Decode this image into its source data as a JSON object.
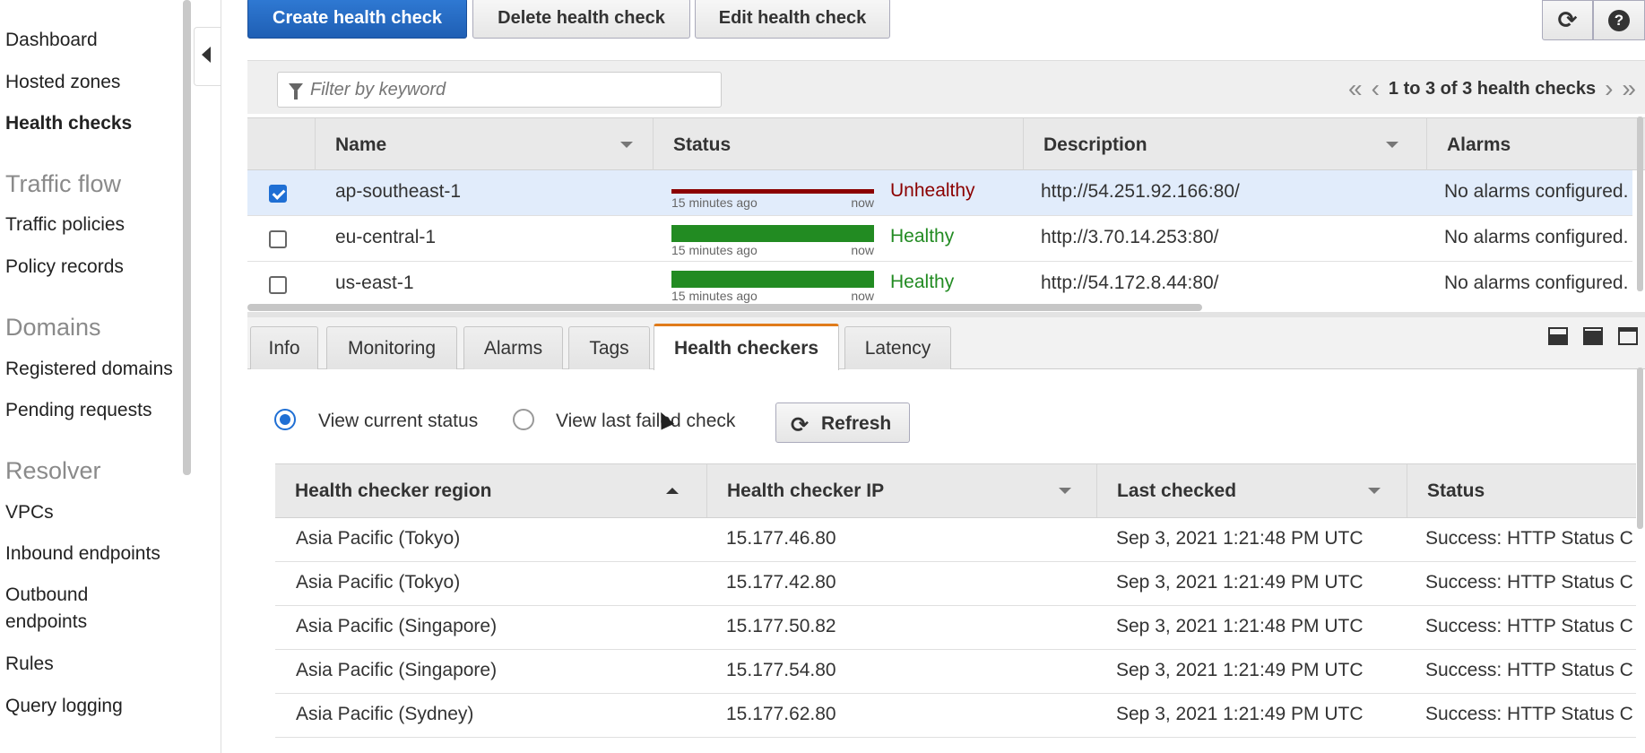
{
  "sidebar": {
    "items": [
      {
        "label": "Dashboard"
      },
      {
        "label": "Hosted zones"
      },
      {
        "label": "Health checks",
        "active": true
      }
    ],
    "sections": [
      {
        "title": "Traffic flow",
        "items": [
          "Traffic policies",
          "Policy records"
        ]
      },
      {
        "title": "Domains",
        "items": [
          "Registered domains",
          "Pending requests"
        ]
      },
      {
        "title": "Resolver",
        "items": [
          "VPCs",
          "Inbound endpoints",
          "Outbound",
          "endpoints",
          "Rules",
          "Query logging"
        ]
      }
    ]
  },
  "toolbar": {
    "create_label": "Create health check",
    "delete_label": "Delete health check",
    "edit_label": "Edit health check"
  },
  "filter": {
    "placeholder": "Filter by keyword"
  },
  "pager": {
    "text": "1 to 3 of 3 health checks"
  },
  "health_checks": {
    "columns": [
      "Name",
      "Status",
      "Description",
      "Alarms"
    ],
    "rows": [
      {
        "name": "ap-southeast-1",
        "ago": "15 minutes ago",
        "now": "now",
        "status": "Unhealthy",
        "description": "http://54.251.92.166:80/",
        "alarms": "No alarms configured.",
        "selected": true
      },
      {
        "name": "eu-central-1",
        "ago": "15 minutes ago",
        "now": "now",
        "status": "Healthy",
        "description": "http://3.70.14.253:80/",
        "alarms": "No alarms configured.",
        "selected": false
      },
      {
        "name": "us-east-1",
        "ago": "15 minutes ago",
        "now": "now",
        "status": "Healthy",
        "description": "http://54.172.8.44:80/",
        "alarms": "No alarms configured.",
        "selected": false
      }
    ]
  },
  "tabs": [
    {
      "label": "Info"
    },
    {
      "label": "Monitoring"
    },
    {
      "label": "Alarms"
    },
    {
      "label": "Tags"
    },
    {
      "label": "Health checkers",
      "active": true
    },
    {
      "label": "Latency"
    }
  ],
  "checkers": {
    "radio_current": "View current status",
    "radio_failed": "View last failed check",
    "refresh_label": "Refresh",
    "columns": [
      "Health checker region",
      "Health checker IP",
      "Last checked",
      "Status"
    ],
    "rows": [
      {
        "region": "Asia Pacific (Tokyo)",
        "ip": "15.177.46.80",
        "last": "Sep 3, 2021 1:21:48 PM UTC",
        "status": "Success: HTTP Status C"
      },
      {
        "region": "Asia Pacific (Tokyo)",
        "ip": "15.177.42.80",
        "last": "Sep 3, 2021 1:21:49 PM UTC",
        "status": "Success: HTTP Status C"
      },
      {
        "region": "Asia Pacific (Singapore)",
        "ip": "15.177.50.82",
        "last": "Sep 3, 2021 1:21:48 PM UTC",
        "status": "Success: HTTP Status C"
      },
      {
        "region": "Asia Pacific (Singapore)",
        "ip": "15.177.54.80",
        "last": "Sep 3, 2021 1:21:49 PM UTC",
        "status": "Success: HTTP Status C"
      },
      {
        "region": "Asia Pacific (Sydney)",
        "ip": "15.177.62.80",
        "last": "Sep 3, 2021 1:21:49 PM UTC",
        "status": "Success: HTTP Status C"
      }
    ]
  },
  "colors": {
    "primary": "#1f64bf",
    "unhealthy": "#8b0000",
    "healthy": "#228b22",
    "active_tab": "#e07b1a"
  }
}
